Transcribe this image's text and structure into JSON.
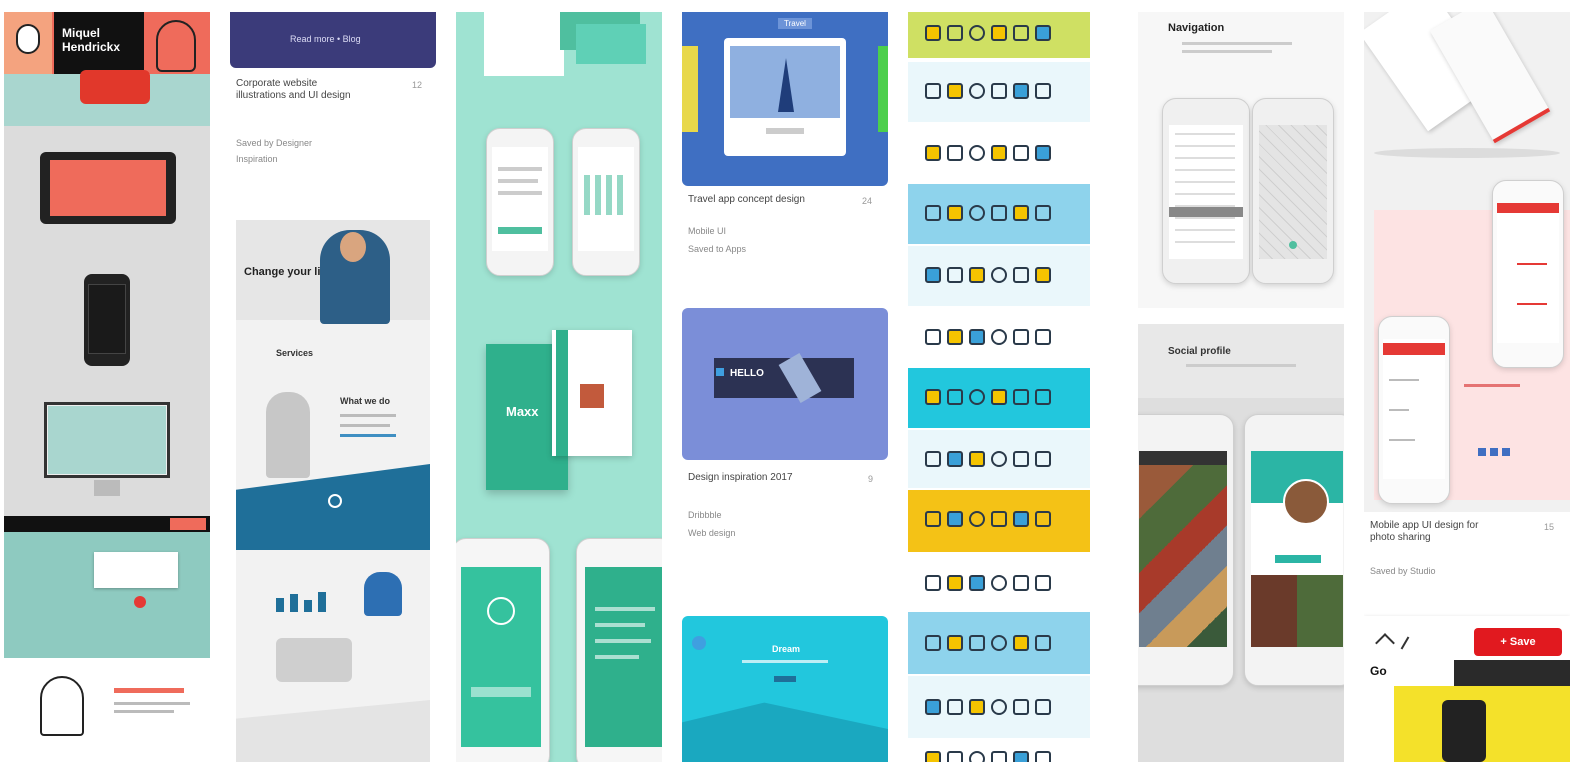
{
  "colors": {
    "salmon": "#ef6b5b",
    "teal": "#5fd0b6",
    "mint": "#9fe3d2",
    "navy": "#3b3b7a",
    "royal": "#3f6fc2",
    "periwinkle": "#7b8ed8",
    "cyan": "#22c7dd",
    "yellow": "#f4c216",
    "lime": "#cfe063",
    "red": "#e53935"
  },
  "col1": {
    "cover_title": "Miquel Hendrickx"
  },
  "col2": {
    "banner_text": "Read more • Blog",
    "pin_title": "Corporate website illustrations and UI design",
    "pin_meta_1": "Saved by Designer",
    "pin_meta_2": "Inspiration",
    "pin_stat": "12",
    "hero_text": "Change your life",
    "section_heading": "Services",
    "feature_heading": "What we do"
  },
  "col3": {
    "app_word": "Maxx"
  },
  "col4": {
    "card_header": "Travel",
    "pin1_title": "Travel app concept design",
    "pin1_meta_1": "Mobile UI",
    "pin1_meta_2": "Saved to Apps",
    "pin1_stat": "24",
    "hero_label": "HELLO",
    "pin2_title": "Design inspiration 2017",
    "pin2_meta_1": "Dribbble",
    "pin2_meta_2": "Web design",
    "pin2_stat": "9",
    "banner_title": "Dream"
  },
  "col5": {
    "theme": "line icon illustrations"
  },
  "col6": {
    "title": "Navigation",
    "subtitle": "Social profile"
  },
  "col7": {
    "pin_title": "Mobile app UI design for photo sharing",
    "pin_meta_1": "Saved by Studio",
    "pin_stat": "15",
    "save_button": "+ Save",
    "promo_word": "Go"
  }
}
